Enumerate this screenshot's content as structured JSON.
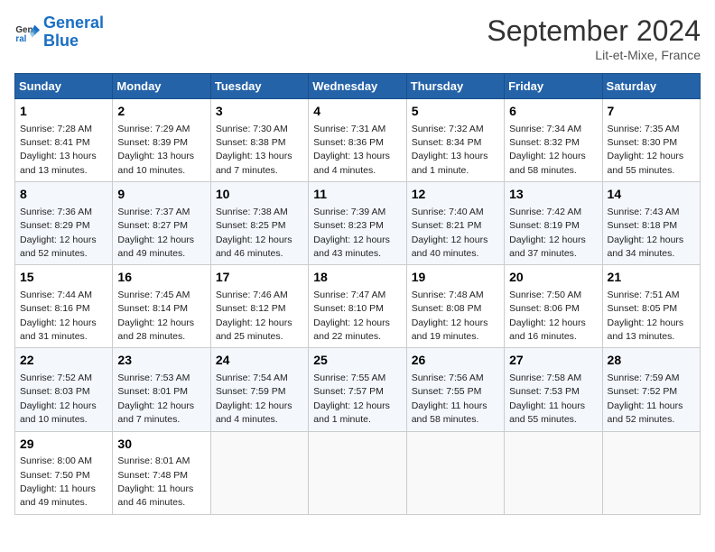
{
  "logo": {
    "line1": "General",
    "line2": "Blue"
  },
  "title": "September 2024",
  "subtitle": "Lit-et-Mixe, France",
  "headers": [
    "Sunday",
    "Monday",
    "Tuesday",
    "Wednesday",
    "Thursday",
    "Friday",
    "Saturday"
  ],
  "weeks": [
    [
      {
        "day": "1",
        "info": "Sunrise: 7:28 AM\nSunset: 8:41 PM\nDaylight: 13 hours\nand 13 minutes."
      },
      {
        "day": "2",
        "info": "Sunrise: 7:29 AM\nSunset: 8:39 PM\nDaylight: 13 hours\nand 10 minutes."
      },
      {
        "day": "3",
        "info": "Sunrise: 7:30 AM\nSunset: 8:38 PM\nDaylight: 13 hours\nand 7 minutes."
      },
      {
        "day": "4",
        "info": "Sunrise: 7:31 AM\nSunset: 8:36 PM\nDaylight: 13 hours\nand 4 minutes."
      },
      {
        "day": "5",
        "info": "Sunrise: 7:32 AM\nSunset: 8:34 PM\nDaylight: 13 hours\nand 1 minute."
      },
      {
        "day": "6",
        "info": "Sunrise: 7:34 AM\nSunset: 8:32 PM\nDaylight: 12 hours\nand 58 minutes."
      },
      {
        "day": "7",
        "info": "Sunrise: 7:35 AM\nSunset: 8:30 PM\nDaylight: 12 hours\nand 55 minutes."
      }
    ],
    [
      {
        "day": "8",
        "info": "Sunrise: 7:36 AM\nSunset: 8:29 PM\nDaylight: 12 hours\nand 52 minutes."
      },
      {
        "day": "9",
        "info": "Sunrise: 7:37 AM\nSunset: 8:27 PM\nDaylight: 12 hours\nand 49 minutes."
      },
      {
        "day": "10",
        "info": "Sunrise: 7:38 AM\nSunset: 8:25 PM\nDaylight: 12 hours\nand 46 minutes."
      },
      {
        "day": "11",
        "info": "Sunrise: 7:39 AM\nSunset: 8:23 PM\nDaylight: 12 hours\nand 43 minutes."
      },
      {
        "day": "12",
        "info": "Sunrise: 7:40 AM\nSunset: 8:21 PM\nDaylight: 12 hours\nand 40 minutes."
      },
      {
        "day": "13",
        "info": "Sunrise: 7:42 AM\nSunset: 8:19 PM\nDaylight: 12 hours\nand 37 minutes."
      },
      {
        "day": "14",
        "info": "Sunrise: 7:43 AM\nSunset: 8:18 PM\nDaylight: 12 hours\nand 34 minutes."
      }
    ],
    [
      {
        "day": "15",
        "info": "Sunrise: 7:44 AM\nSunset: 8:16 PM\nDaylight: 12 hours\nand 31 minutes."
      },
      {
        "day": "16",
        "info": "Sunrise: 7:45 AM\nSunset: 8:14 PM\nDaylight: 12 hours\nand 28 minutes."
      },
      {
        "day": "17",
        "info": "Sunrise: 7:46 AM\nSunset: 8:12 PM\nDaylight: 12 hours\nand 25 minutes."
      },
      {
        "day": "18",
        "info": "Sunrise: 7:47 AM\nSunset: 8:10 PM\nDaylight: 12 hours\nand 22 minutes."
      },
      {
        "day": "19",
        "info": "Sunrise: 7:48 AM\nSunset: 8:08 PM\nDaylight: 12 hours\nand 19 minutes."
      },
      {
        "day": "20",
        "info": "Sunrise: 7:50 AM\nSunset: 8:06 PM\nDaylight: 12 hours\nand 16 minutes."
      },
      {
        "day": "21",
        "info": "Sunrise: 7:51 AM\nSunset: 8:05 PM\nDaylight: 12 hours\nand 13 minutes."
      }
    ],
    [
      {
        "day": "22",
        "info": "Sunrise: 7:52 AM\nSunset: 8:03 PM\nDaylight: 12 hours\nand 10 minutes."
      },
      {
        "day": "23",
        "info": "Sunrise: 7:53 AM\nSunset: 8:01 PM\nDaylight: 12 hours\nand 7 minutes."
      },
      {
        "day": "24",
        "info": "Sunrise: 7:54 AM\nSunset: 7:59 PM\nDaylight: 12 hours\nand 4 minutes."
      },
      {
        "day": "25",
        "info": "Sunrise: 7:55 AM\nSunset: 7:57 PM\nDaylight: 12 hours\nand 1 minute."
      },
      {
        "day": "26",
        "info": "Sunrise: 7:56 AM\nSunset: 7:55 PM\nDaylight: 11 hours\nand 58 minutes."
      },
      {
        "day": "27",
        "info": "Sunrise: 7:58 AM\nSunset: 7:53 PM\nDaylight: 11 hours\nand 55 minutes."
      },
      {
        "day": "28",
        "info": "Sunrise: 7:59 AM\nSunset: 7:52 PM\nDaylight: 11 hours\nand 52 minutes."
      }
    ],
    [
      {
        "day": "29",
        "info": "Sunrise: 8:00 AM\nSunset: 7:50 PM\nDaylight: 11 hours\nand 49 minutes."
      },
      {
        "day": "30",
        "info": "Sunrise: 8:01 AM\nSunset: 7:48 PM\nDaylight: 11 hours\nand 46 minutes."
      },
      null,
      null,
      null,
      null,
      null
    ]
  ]
}
